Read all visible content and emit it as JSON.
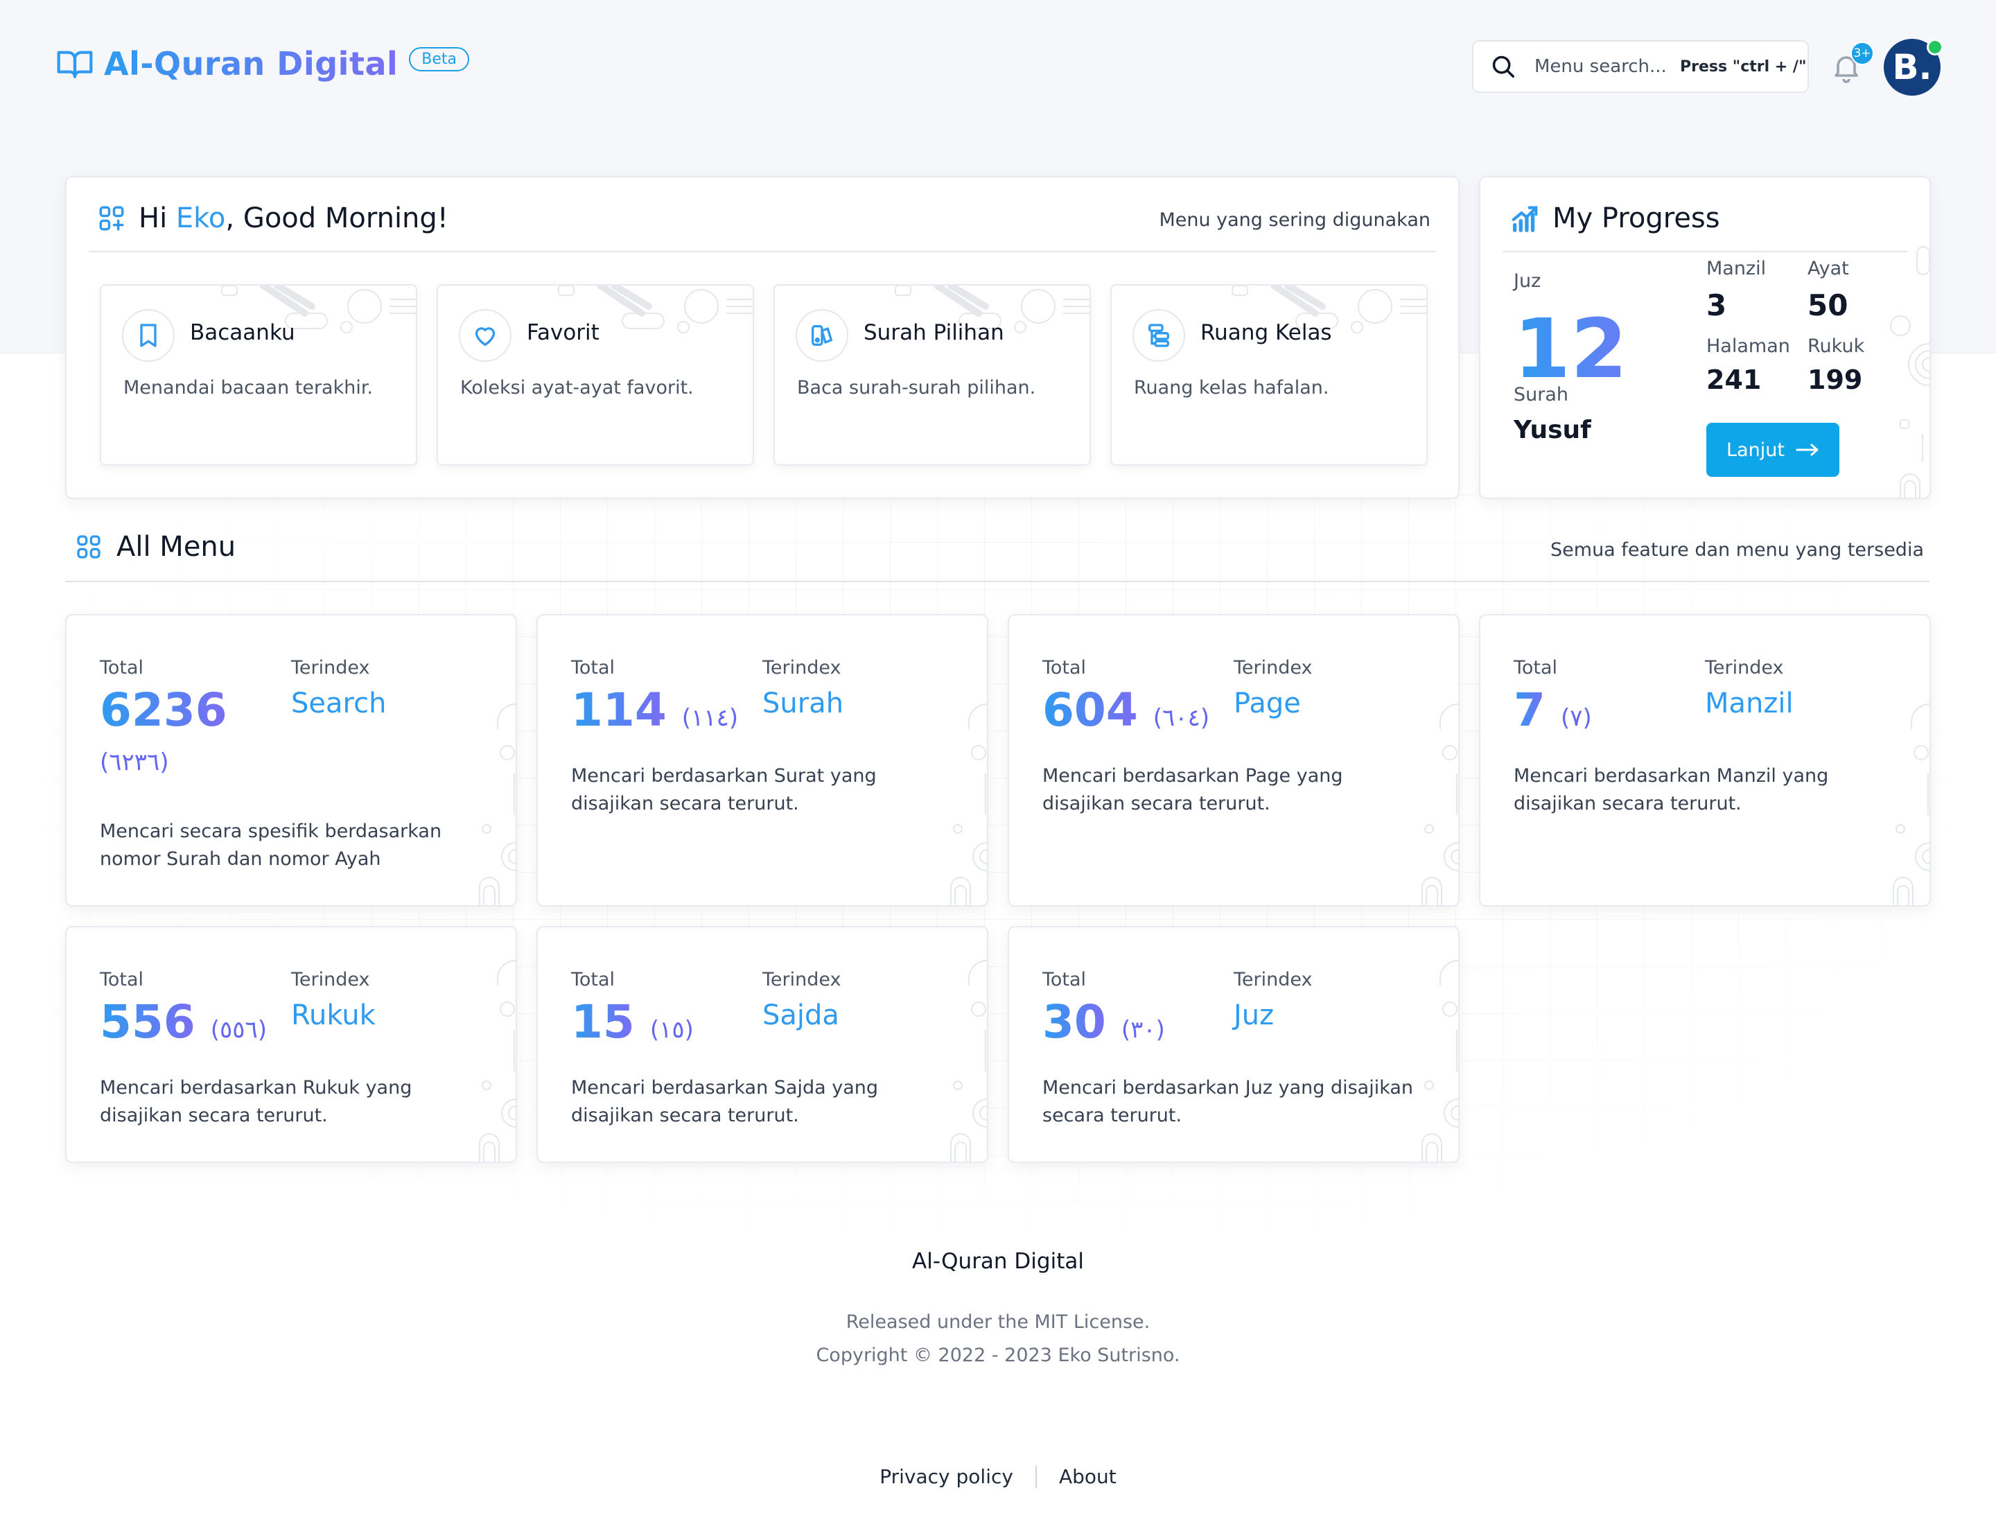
{
  "header": {
    "app_title": "Al-Quran Digital",
    "badge": "Beta",
    "search_placeholder": "Menu search...",
    "search_hint": "Press \"ctrl + /\"",
    "notification_count": "3+",
    "avatar_initial": "B."
  },
  "greeting": {
    "prefix": "Hi ",
    "name": "Eko",
    "suffix": ", Good Morning!",
    "subtitle": "Menu yang sering digunakan",
    "favorites": [
      {
        "icon": "bookmark-icon",
        "title": "Bacaanku",
        "desc": "Menandai bacaan terakhir."
      },
      {
        "icon": "heart-icon",
        "title": "Favorit",
        "desc": "Koleksi ayat-ayat favorit."
      },
      {
        "icon": "book-select-icon",
        "title": "Surah Pilihan",
        "desc": "Baca surah-surah pilihan."
      },
      {
        "icon": "classroom-icon",
        "title": "Ruang Kelas",
        "desc": "Ruang kelas hafalan."
      }
    ]
  },
  "progress": {
    "title": "My Progress",
    "juz_label": "Juz",
    "juz_value": "12",
    "surah_label": "Surah",
    "surah_value": "Yusuf",
    "manzil_label": "Manzil",
    "manzil_value": "3",
    "ayat_label": "Ayat",
    "ayat_value": "50",
    "halaman_label": "Halaman",
    "halaman_value": "241",
    "rukuk_label": "Rukuk",
    "rukuk_value": "199",
    "button_label": "Lanjut"
  },
  "all_menu": {
    "title": "All Menu",
    "subtitle": "Semua feature dan menu yang tersedia",
    "total_label": "Total",
    "index_label": "Terindex",
    "items": [
      {
        "total": "6236",
        "arabic": "(٦٢٣٦)",
        "index": "Search",
        "desc": "Mencari secara spesifik berdasarkan nomor Surah dan nomor Ayah"
      },
      {
        "total": "114",
        "arabic": "(١١٤)",
        "index": "Surah",
        "desc": "Mencari berdasarkan Surat yang disajikan secara terurut."
      },
      {
        "total": "604",
        "arabic": "(٦٠٤)",
        "index": "Page",
        "desc": "Mencari berdasarkan Page yang disajikan secara terurut."
      },
      {
        "total": "7",
        "arabic": "(٧)",
        "index": "Manzil",
        "desc": "Mencari berdasarkan Manzil yang disajikan secara terurut."
      },
      {
        "total": "556",
        "arabic": "(٥٥٦)",
        "index": "Rukuk",
        "desc": "Mencari berdasarkan Rukuk yang disajikan secara terurut."
      },
      {
        "total": "15",
        "arabic": "(١٥)",
        "index": "Sajda",
        "desc": "Mencari berdasarkan Sajda yang disajikan secara terurut."
      },
      {
        "total": "30",
        "arabic": "(٣٠)",
        "index": "Juz",
        "desc": "Mencari berdasarkan Juz yang disajikan secara terurut."
      }
    ]
  },
  "footer": {
    "title": "Al-Quran Digital",
    "license": "Released under the MIT License.",
    "copyright": "Copyright © 2022 - 2023 Eko Sutrisno.",
    "links": [
      "Privacy policy",
      "About"
    ]
  },
  "colors": {
    "accent": "#2f9bf0",
    "accent_secondary": "#7b6df2",
    "button": "#0ea5e9",
    "arabic_numerals": "#6366f1",
    "avatar": "#143f7e",
    "online_dot": "#22c55e"
  }
}
